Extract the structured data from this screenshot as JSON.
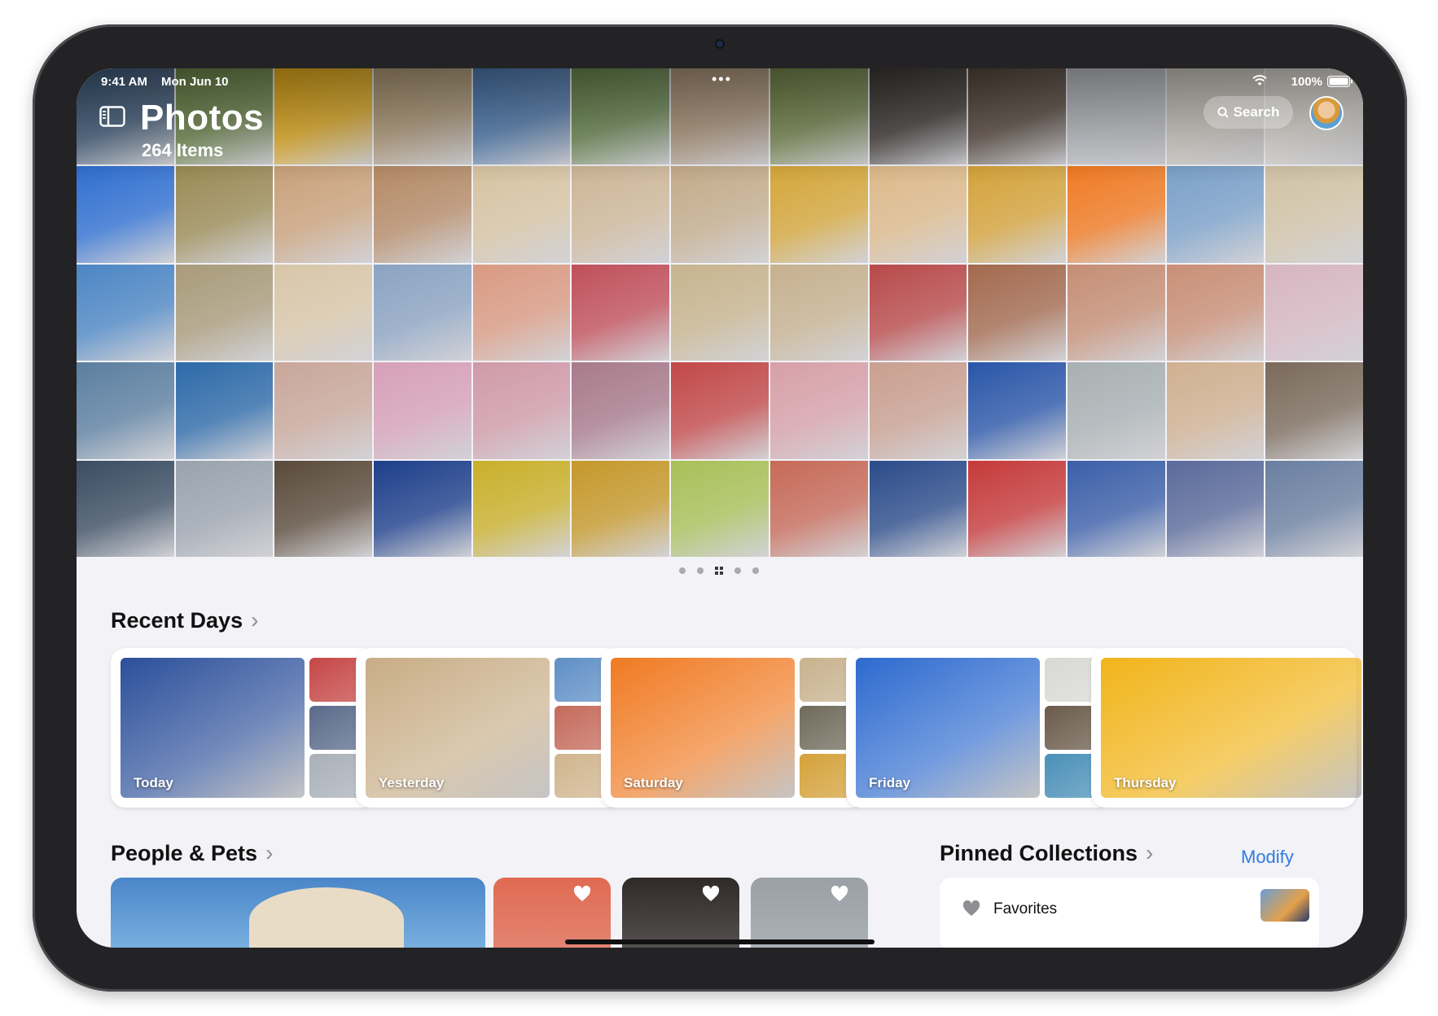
{
  "status_bar": {
    "time": "9:41 AM",
    "date": "Mon Jun 10",
    "battery": "100%"
  },
  "header": {
    "title": "Photos",
    "item_count": "264 Items",
    "search_label": "Search"
  },
  "photo_grid_colors": [
    "#3d5a7a",
    "#6f8a4a",
    "#f1b41a",
    "#b8a07a",
    "#4f7fb8",
    "#6e8f52",
    "#b59a7c",
    "#7a8c4d",
    "#3f3a36",
    "#5a4b3f",
    "#c4c7cc",
    "#d7d2c8",
    "#e4e0d8",
    "#2f6fd0",
    "#9a8a55",
    "#c9a17a",
    "#b48a66",
    "#d6c3a1",
    "#cdb697",
    "#c3ab8a",
    "#d4a63a",
    "#dcb98a",
    "#d4a23a",
    "#f07a22",
    "#7aa0c8",
    "#d0c2a6",
    "#4c86c4",
    "#a99b7a",
    "#d8c6a8",
    "#8ba3c2",
    "#d99a82",
    "#c0505a",
    "#c7b48e",
    "#c6b18f",
    "#b84a4a",
    "#a36a4e",
    "#c58e74",
    "#c98f76",
    "#d6b6c0",
    "#5b7fa0",
    "#2d6aa8",
    "#c9a79a",
    "#d6a0b8",
    "#d09aa8",
    "#a87a8a",
    "#c24848",
    "#d7a0a8",
    "#c9a090",
    "#2a56a8",
    "#a8b0b2",
    "#d0b090",
    "#7a6a5a",
    "#3b4d62",
    "#9aa3ad",
    "#5a4a3a",
    "#1d3f8a",
    "#c9b02a",
    "#c5982a",
    "#a8c058",
    "#c66a58",
    "#2b4c8a",
    "#c63a3a",
    "#3b5fa8",
    "#5a6a9a",
    "#6a7fa0"
  ],
  "recent_days": {
    "title": "Recent Days",
    "cards": [
      {
        "label": "Today",
        "main_color": "#2b4f9a",
        "thumbs": [
          "#c64646",
          "#5a6a8a",
          "#a9b0b8"
        ]
      },
      {
        "label": "Yesterday",
        "main_color": "#c8ad86",
        "thumbs": [
          "#5f8fc6",
          "#c46a5a",
          "#d0b58e"
        ]
      },
      {
        "label": "Saturday",
        "main_color": "#f07a22",
        "thumbs": [
          "#c8b28e",
          "#6f6a5a",
          "#d4a23a"
        ]
      },
      {
        "label": "Friday",
        "main_color": "#2d6acf",
        "thumbs": [
          "#d8d8d4",
          "#6a5a4a",
          "#4a90b8"
        ]
      },
      {
        "label": "Thursday",
        "main_color": "#f1b41a",
        "thumbs": []
      }
    ]
  },
  "people_pets": {
    "title": "People & Pets",
    "tile_colors": [
      "#e06a52",
      "#2f2a28",
      "#9aa0a6"
    ]
  },
  "pinned": {
    "title": "Pinned Collections",
    "modify_label": "Modify",
    "favorites_label": "Favorites"
  }
}
